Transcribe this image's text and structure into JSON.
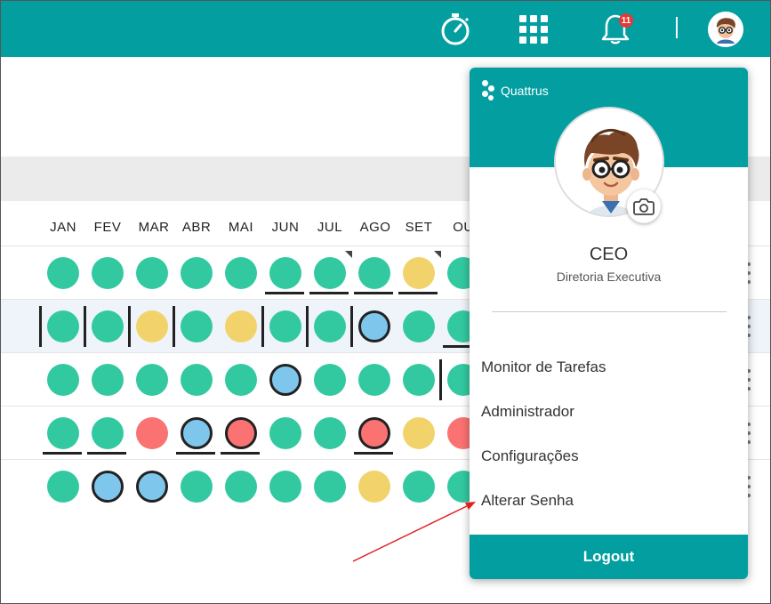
{
  "topbar": {
    "icons": [
      "stopwatch-icon",
      "apps-grid-icon",
      "bell-icon",
      "user-avatar"
    ],
    "notification_count": "11",
    "color": "#039ea0"
  },
  "months": [
    "JAN",
    "FEV",
    "MAR",
    "ABR",
    "MAI",
    "JUN",
    "JUL",
    "AGO",
    "SET",
    "OU"
  ],
  "grid": {
    "colors": {
      "green": "#33c9a0",
      "yellow": "#f2d36b",
      "red": "#fb7272",
      "blue": "#7ec6ec"
    },
    "rows": [
      [
        "green",
        "green",
        "green",
        "green",
        "green",
        "green",
        "green",
        "green",
        "yellow",
        "green"
      ],
      [
        "green",
        "green",
        "yellow",
        "green",
        "yellow",
        "green",
        "green",
        "blue",
        "green",
        "green"
      ],
      [
        "green",
        "green",
        "green",
        "green",
        "green",
        "blue",
        "green",
        "green",
        "green",
        "green"
      ],
      [
        "green",
        "green",
        "red",
        "blue",
        "red",
        "green",
        "green",
        "red",
        "yellow",
        "red"
      ],
      [
        "green",
        "blue",
        "blue",
        "green",
        "green",
        "green",
        "green",
        "yellow",
        "green",
        "green"
      ]
    ]
  },
  "panel": {
    "brand": "Quattrus",
    "role": "CEO",
    "department": "Diretoria Executiva",
    "menu": [
      "Monitor de Tarefas",
      "Administrador",
      "Configurações",
      "Alterar Senha"
    ],
    "logout": "Logout"
  },
  "annotation": {
    "arrow_color": "#e02020",
    "points_to": "Alterar Senha"
  }
}
